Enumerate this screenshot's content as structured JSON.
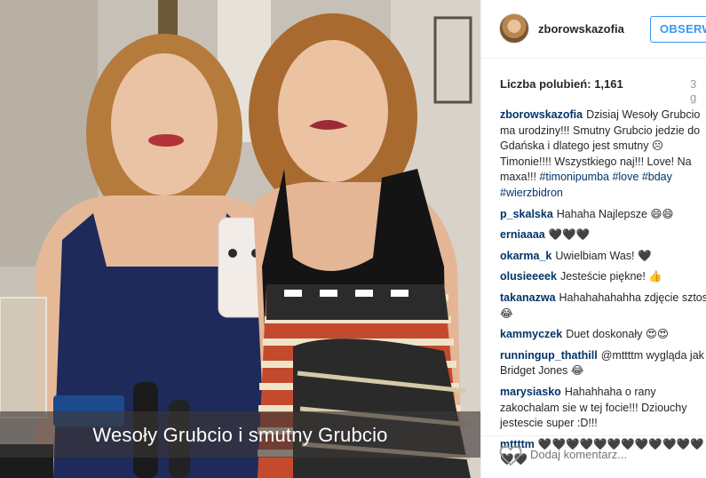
{
  "photo": {
    "caption": "Wesoły Grubcio i smutny Grubcio"
  },
  "header": {
    "username": "zborowskazofia",
    "follow_label": "OBSERW"
  },
  "stats": {
    "likes_label": "Liczba polubień:",
    "likes_count": "1,161",
    "time": "3 g"
  },
  "comments": [
    {
      "user": "zborowskazofia",
      "text": "Dzisiaj Wesoły Grubcio ma urodziny!!! Smutny Grubcio jedzie do Gdańska i dlatego jest smutny ☹ Timonie!!!! Wszystkiego naj!!! Love! Na maxa!!! ",
      "tags": "#timonipumba #love #bday #wierzbidron"
    },
    {
      "user": "p_skalska",
      "text": "Hahaha Najlepsze 😄😄"
    },
    {
      "user": "erniaaaa",
      "text": "🖤🖤🖤"
    },
    {
      "user": "okarma_k",
      "text": "Uwielbiam Was! 🖤"
    },
    {
      "user": "olusieeeek",
      "text": "Jesteście piękne! 👍"
    },
    {
      "user": "takanazwa",
      "text": "Hahahahahahha zdjęcie sztos! 😂"
    },
    {
      "user": "kammyczek",
      "text": "Duet doskonały 😍😍"
    },
    {
      "user": "runningup_thathill",
      "text": "@mttttm wygląda jak Bridget Jones 😂"
    },
    {
      "user": "marysiasko",
      "text": "Hahahhaha o rany zakochalam sie w tej focie!!! Dziouchy jestescie super :D!!!"
    },
    {
      "user": "mttttm",
      "text": "🖤🖤🖤🖤🖤🖤🖤🖤🖤🖤🖤🖤🖤🖤"
    }
  ],
  "footer": {
    "add_comment_placeholder": "Dodaj komentarz..."
  },
  "colors": {
    "accent": "#3897f0",
    "username": "#003569",
    "muted": "#999999"
  }
}
